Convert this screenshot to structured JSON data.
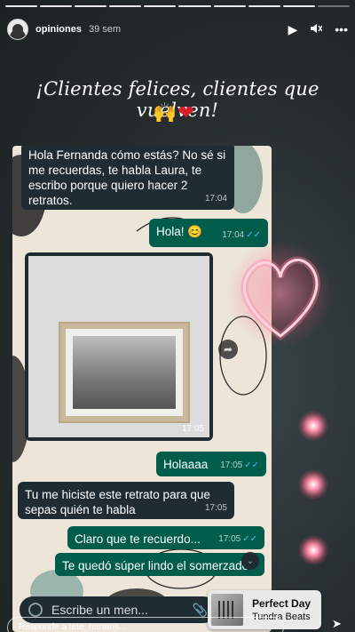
{
  "story": {
    "username": "opiniones",
    "time_ago": "39 sem",
    "controls": {
      "play_icon": "play-icon",
      "mute_icon": "mute-icon",
      "more": "•••"
    }
  },
  "title": "¡Clientes felices, clientes que vuelven!",
  "emojis": {
    "hands": "🙌",
    "heart": "❤"
  },
  "chat": {
    "messages": [
      {
        "text": "Hola Fernanda cómo estás? No sé si me recuerdas, te habla Laura,   te escribo porque quiero hacer 2 retratos.",
        "time": "17:04"
      },
      {
        "text": "Hola! 😊",
        "time": "17:04"
      },
      {
        "time": "17:05"
      },
      {
        "text": "Holaaaa",
        "time": "17:05"
      },
      {
        "text": "Tu me hiciste este retrato para que sepas quién te habla",
        "time": "17:05"
      },
      {
        "text": "Claro que te recuerdo...",
        "time": "17:05"
      },
      {
        "text": "Te quedó súper lindo el somerzado!"
      }
    ],
    "input_placeholder": "Escribe un men..."
  },
  "music": {
    "title": "Perfect Day",
    "artist": "Tundra Beats"
  },
  "reply": {
    "placeholder": "Responde a tete_retratos..."
  },
  "colors": {
    "incoming_bubble": "#1f2c33",
    "outgoing_bubble": "#005c4b",
    "chat_bg": "#ece5d8",
    "heart": "#d81f26",
    "glow": "#ff6f91"
  }
}
